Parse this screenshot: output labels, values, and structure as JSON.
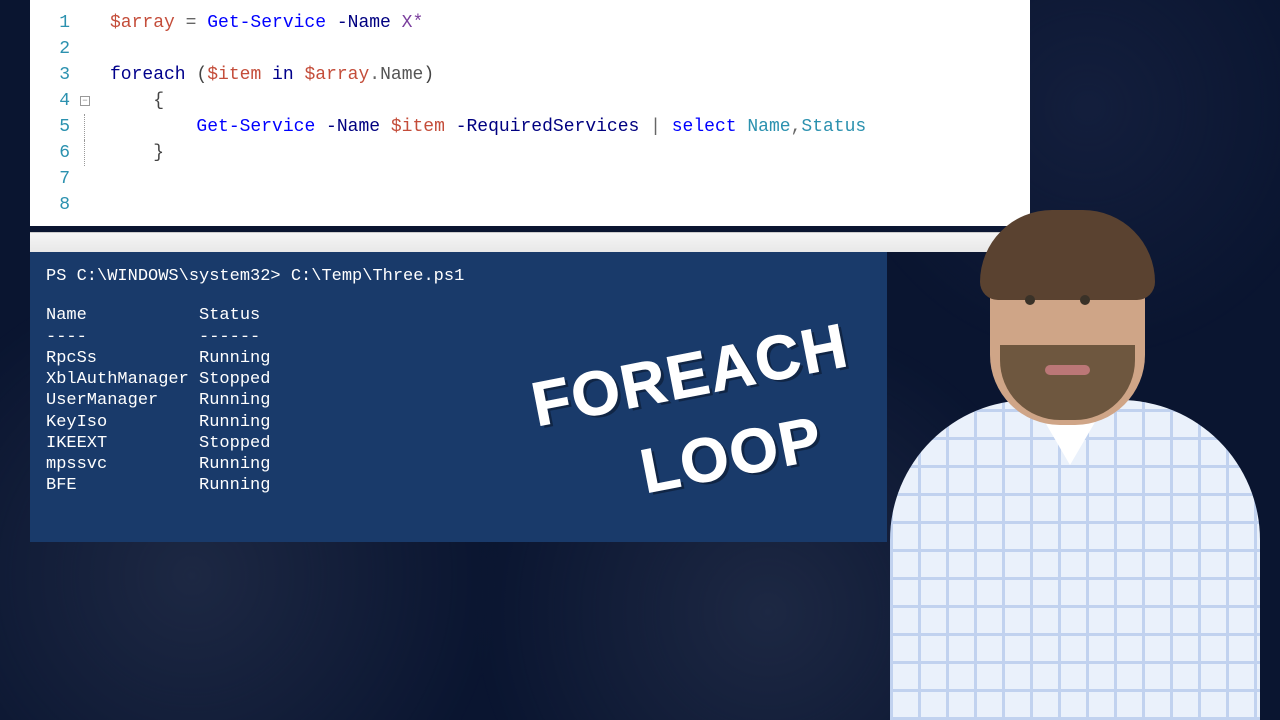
{
  "editor": {
    "lines": {
      "1": {
        "num": "1"
      },
      "2": {
        "num": "2"
      },
      "3": {
        "num": "3"
      },
      "4": {
        "num": "4"
      },
      "5": {
        "num": "5"
      },
      "6": {
        "num": "6"
      },
      "7": {
        "num": "7"
      },
      "8": {
        "num": "8"
      }
    },
    "code": {
      "l1_var": "$array",
      "l1_op": " = ",
      "l1_cmd": "Get-Service",
      "l1_param": " -Name ",
      "l1_arg": "X*",
      "l3_kw": "foreach",
      "l3_open": " (",
      "l3_item": "$item",
      "l3_in": " in ",
      "l3_arr": "$array",
      "l3_dot": ".",
      "l3_prop": "Name",
      "l3_close": ")",
      "l4_brace": "    {",
      "l5_indent": "        ",
      "l5_cmd": "Get-Service",
      "l5_param1": " -Name ",
      "l5_var": "$item",
      "l5_param2": " -RequiredServices",
      "l5_pipe": " | ",
      "l5_select": "select",
      "l5_space": " ",
      "l5_cols_name": "Name",
      "l5_comma": ",",
      "l5_cols_status": "Status",
      "l6_brace": "    }"
    }
  },
  "terminal": {
    "prompt_label": "PS C:\\WINDOWS\\system32>",
    "script_path": "C:\\Temp\\Three.ps1",
    "header_name": "Name",
    "header_status": "Status",
    "divider_name": "----",
    "divider_status": "------",
    "rows": [
      {
        "name": "RpcSs",
        "status": "Running"
      },
      {
        "name": "XblAuthManager",
        "status": "Stopped"
      },
      {
        "name": "UserManager",
        "status": "Running"
      },
      {
        "name": "KeyIso",
        "status": "Running"
      },
      {
        "name": "IKEEXT",
        "status": "Stopped"
      },
      {
        "name": "mpssvc",
        "status": "Running"
      },
      {
        "name": "BFE",
        "status": "Running"
      }
    ]
  },
  "overlay": {
    "line1": "FOREACH",
    "line2": "LOOP"
  }
}
